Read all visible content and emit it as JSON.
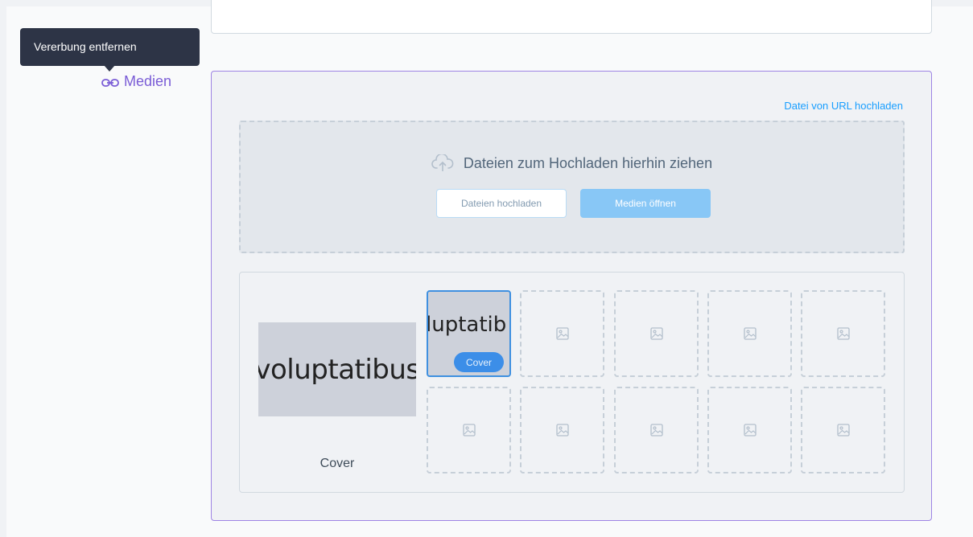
{
  "tooltip": {
    "text": "Vererbung entfernen"
  },
  "field": {
    "label": "Medien",
    "icon": "link-icon"
  },
  "media": {
    "url_upload_link": "Datei von URL hochladen",
    "dropzone": {
      "text": "Dateien zum Hochladen hierhin ziehen",
      "icon": "cloud-upload-icon",
      "upload_button": "Dateien hochladen",
      "open_button": "Medien öffnen"
    },
    "cover": {
      "preview_text": "voluptatibus",
      "caption": "Cover"
    },
    "thumbnails": {
      "active_text": "luptatib",
      "cover_badge": "Cover",
      "placeholder_icon": "image-icon",
      "placeholder_count": 9
    }
  },
  "colors": {
    "accent": "#7a5cd6",
    "link": "#189eff",
    "primary_button": "#88c7f6",
    "tooltip_bg": "#2d3446",
    "badge": "#3c8ee8"
  }
}
